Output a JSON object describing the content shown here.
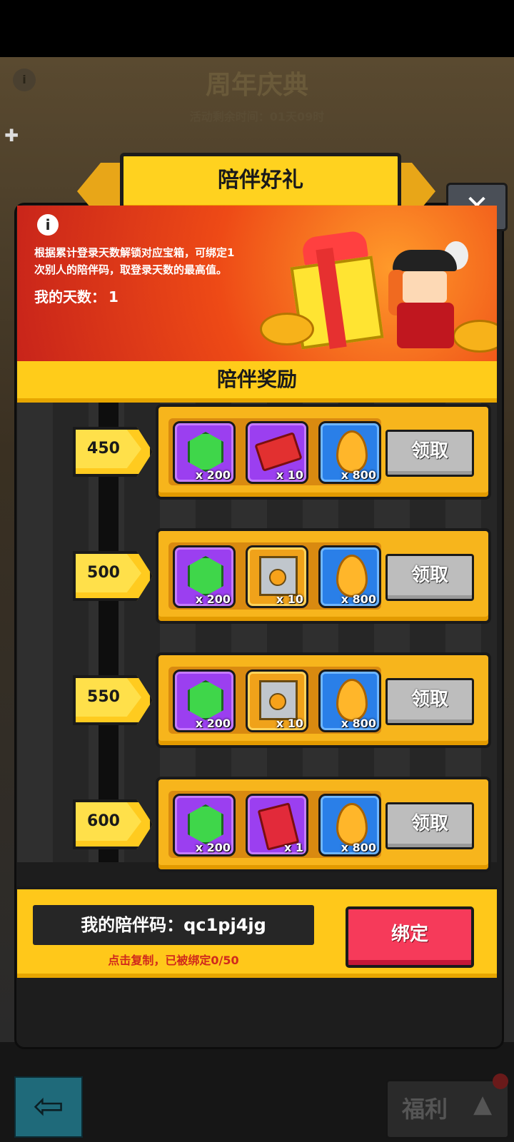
{
  "background": {
    "event_title": "周年庆典",
    "event_countdown": "活动剩余时间：01天09时"
  },
  "popup": {
    "title": "陪伴好礼",
    "close_symbol": "✕",
    "info_symbol": "i",
    "description_line1": "根据累计登录天数解锁对应宝箱，可绑定1",
    "description_line2": "次别人的陪伴码，取登录天数的最高值。",
    "my_days_label": "我的天数：",
    "my_days_value": "1",
    "section_title": "陪伴奖励"
  },
  "rewards": [
    {
      "days": "450",
      "items": [
        {
          "icon": "green-gem",
          "qty": "x 200"
        },
        {
          "icon": "crown-ticket",
          "qty": "x 10"
        },
        {
          "icon": "golden-flame",
          "qty": "x 800"
        }
      ],
      "button": "领取"
    },
    {
      "days": "500",
      "items": [
        {
          "icon": "green-gem",
          "qty": "x 200"
        },
        {
          "icon": "treasure-chest",
          "qty": "x 10"
        },
        {
          "icon": "golden-flame",
          "qty": "x 800"
        }
      ],
      "button": "领取"
    },
    {
      "days": "550",
      "items": [
        {
          "icon": "green-gem",
          "qty": "x 200"
        },
        {
          "icon": "treasure-chest",
          "qty": "x 10"
        },
        {
          "icon": "golden-flame",
          "qty": "x 800"
        }
      ],
      "button": "领取"
    },
    {
      "days": "600",
      "items": [
        {
          "icon": "green-gem",
          "qty": "x 200"
        },
        {
          "icon": "heart-envelope",
          "qty": "x 1"
        },
        {
          "icon": "golden-flame",
          "qty": "x 800"
        }
      ],
      "button": "领取"
    }
  ],
  "footer": {
    "my_code": "我的陪伴码：qc1pj4jg",
    "copy_hint": "点击复制，已被绑定0/50",
    "bind_button": "绑定"
  },
  "bottom_nav": {
    "back_symbol": "⇦",
    "welfare_label": "福利",
    "welfare_arrow": "▲"
  }
}
